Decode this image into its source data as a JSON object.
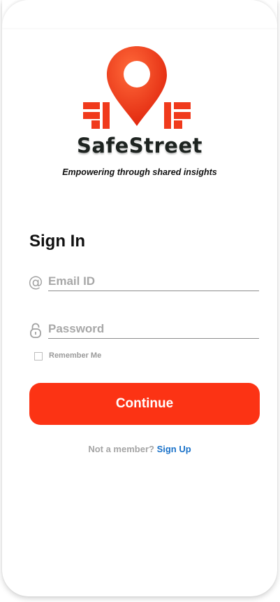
{
  "brand": {
    "name": "SafeStreet",
    "tagline": "Empowering through shared insights",
    "accent_color": "#fc3314",
    "logo_icon": "map-pin-street-icon"
  },
  "signin": {
    "title": "Sign In",
    "email": {
      "icon": "at-sign-icon",
      "icon_glyph": "@",
      "placeholder": "Email ID",
      "value": ""
    },
    "password": {
      "icon": "lock-icon",
      "placeholder": "Password",
      "value": ""
    },
    "remember_me": {
      "label": "Remember Me",
      "checked": false
    },
    "continue_label": "Continue"
  },
  "footer": {
    "prompt": "Not a member?",
    "signup_label": "Sign Up",
    "link_color": "#1a72c9"
  }
}
